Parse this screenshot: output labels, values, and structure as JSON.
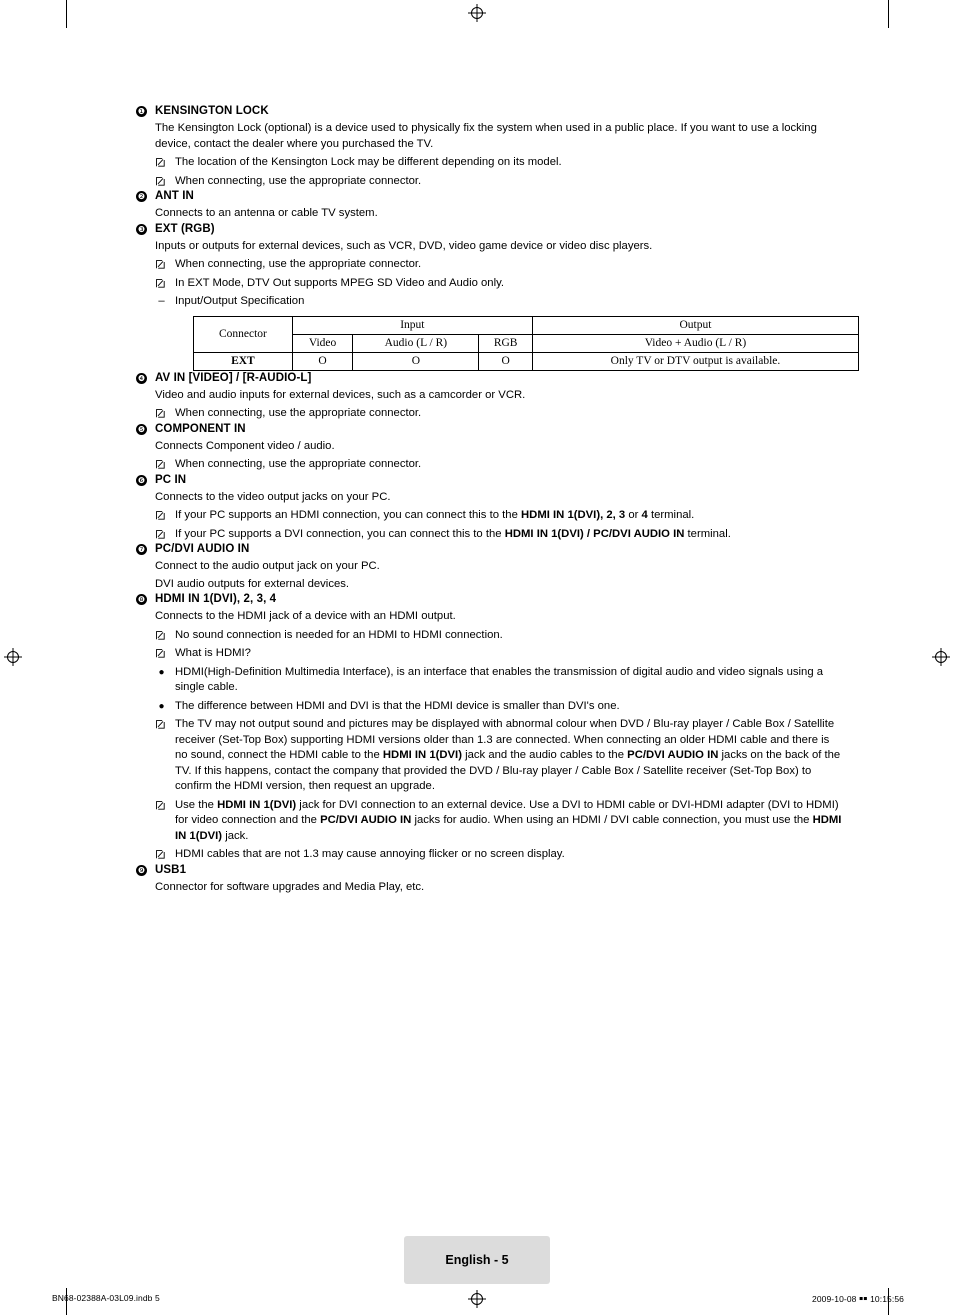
{
  "page": {
    "footer_badge": "English - 5",
    "footer_left": "BN68-02388A-03L09.indb   5",
    "footer_right": "2009-10-08   ￭￭ 10:15:56"
  },
  "items": [
    {
      "num": "❶",
      "title": "KENSINGTON LOCK",
      "paras": [
        "The Kensington Lock (optional) is a device used to physically fix the system when used in a public place. If you want to use a locking device, contact the dealer where you purchased the TV."
      ],
      "notes": [
        {
          "type": "note",
          "text": "The location of the Kensington Lock may be different depending on its model."
        },
        {
          "type": "note",
          "text": "When connecting, use the appropriate connector."
        }
      ]
    },
    {
      "num": "❷",
      "title": "ANT IN",
      "paras": [
        "Connects to an antenna or cable TV system."
      ],
      "notes": []
    },
    {
      "num": "❸",
      "title": "EXT (RGB)",
      "paras": [
        "Inputs or outputs for external devices, such as VCR, DVD, video game device or video disc players."
      ],
      "notes": [
        {
          "type": "note",
          "text": "When connecting, use the appropriate connector."
        },
        {
          "type": "note",
          "text": "In EXT Mode, DTV Out supports MPEG SD Video and Audio only."
        },
        {
          "type": "dash",
          "text": "Input/Output Specification"
        }
      ],
      "table": {
        "connector_header": "Connector",
        "input_header": "Input",
        "output_header": "Output",
        "sub_headers": [
          "Video",
          "Audio (L / R)",
          "RGB"
        ],
        "output_sub_header": "Video + Audio (L / R)",
        "rows": [
          {
            "connector": "EXT",
            "video": "O",
            "audio": "O",
            "rgb": "O",
            "output": "Only TV or DTV output is available."
          }
        ]
      }
    },
    {
      "num": "❹",
      "title": "AV IN [VIDEO] / [R-AUDIO-L]",
      "paras": [
        "Video and audio inputs for external devices, such as a camcorder or VCR."
      ],
      "notes": [
        {
          "type": "note",
          "text": "When connecting, use the appropriate connector."
        }
      ]
    },
    {
      "num": "❺",
      "title": "COMPONENT IN",
      "paras": [
        "Connects Component video / audio."
      ],
      "notes": [
        {
          "type": "note",
          "text": "When connecting, use the appropriate connector."
        }
      ]
    },
    {
      "num": "❻",
      "title": "PC IN",
      "paras": [
        "Connects to the video output jacks on your PC."
      ],
      "notes": [
        {
          "type": "note",
          "html": "If your PC supports an HDMI connection, you can connect this to the <b>HDMI IN 1(DVI), 2, 3</b> or <b>4</b> terminal."
        },
        {
          "type": "note",
          "html": "If your PC supports a DVI connection, you can connect this to the <b>HDMI IN 1(DVI) / PC/DVI AUDIO IN</b> terminal."
        }
      ]
    },
    {
      "num": "❼",
      "title": "PC/DVI AUDIO IN",
      "paras": [
        "Connect to the audio output jack on your PC.",
        "DVI audio outputs for external devices."
      ],
      "notes": []
    },
    {
      "num": "❽",
      "title": "HDMI IN 1(DVI), 2, 3, 4",
      "paras": [
        "Connects to the HDMI jack of a device with an HDMI output."
      ],
      "notes": [
        {
          "type": "note",
          "text": "No sound connection is needed for an HDMI to HDMI connection."
        },
        {
          "type": "note",
          "text": "What is HDMI?"
        },
        {
          "type": "bullet",
          "text": "HDMI(High-Definition Multimedia Interface), is an interface that enables the transmission of digital audio and video signals using a single cable."
        },
        {
          "type": "bullet",
          "text": "The difference between HDMI and DVI is that the HDMI device is smaller than DVI's one."
        },
        {
          "type": "note",
          "html": "The TV may not output sound and pictures may be displayed with abnormal colour when DVD / Blu-ray player / Cable Box / Satellite receiver (Set-Top Box) supporting HDMI versions older than 1.3 are connected. When connecting an older HDMI cable and there is no sound, connect the HDMI cable to the <b>HDMI IN 1(DVI)</b> jack and the audio cables to the <b>PC/DVI AUDIO IN</b> jacks on the back of the TV. If this happens, contact the company that provided the DVD / Blu-ray player / Cable Box / Satellite receiver (Set-Top Box) to confirm the HDMI version, then request an upgrade."
        },
        {
          "type": "note",
          "html": "Use the <b>HDMI IN 1(DVI)</b> jack for DVI connection to an external device. Use a DVI to HDMI cable or DVI-HDMI adapter (DVI to HDMI) for video connection and the <b>PC/DVI AUDIO IN</b> jacks for audio. When using an HDMI / DVI cable connection, you must use the <b>HDMI IN 1(DVI)</b> jack."
        },
        {
          "type": "note",
          "text": "HDMI cables that are not 1.3 may cause annoying flicker or no screen display."
        }
      ]
    },
    {
      "num": "❾",
      "title": "USB1",
      "paras": [
        "Connector for software upgrades and Media Play, etc."
      ],
      "notes": []
    }
  ]
}
